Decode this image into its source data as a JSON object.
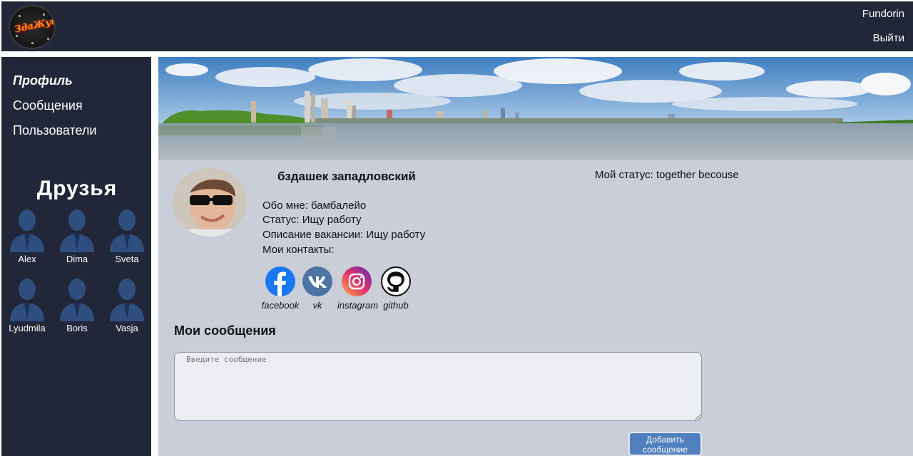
{
  "header": {
    "logo_text": "ЗдаЖуй",
    "login_name": "Fundorin",
    "logout_label": "Выйти"
  },
  "sidebar": {
    "nav": [
      {
        "label": "Профиль",
        "active": true
      },
      {
        "label": "Сообщения",
        "active": false
      },
      {
        "label": "Пользователи",
        "active": false
      }
    ],
    "friends_title": "Друзья",
    "friends": [
      "Alex",
      "Dima",
      "Sveta",
      "Lyudmila",
      "Boris",
      "Vasja"
    ]
  },
  "profile": {
    "full_name": "бздашек западловский",
    "my_status": "Мой статус: together becouse",
    "about": "Обо мне: бамбалейо",
    "job_status": "Статус: Ищу работу",
    "job_description": "Описание вакансии: Ищу работу",
    "contacts_label": "Мои контакты:",
    "contacts": [
      {
        "label": "facebook",
        "icon": "facebook-icon",
        "color": "#1877f2"
      },
      {
        "label": "vk",
        "icon": "vk-icon",
        "color": "#4c75a3"
      },
      {
        "label": "instagram",
        "icon": "instagram-icon",
        "color": "#d6249f"
      },
      {
        "label": "github",
        "icon": "github-icon",
        "color": "#111111"
      }
    ]
  },
  "posts": {
    "title": "Мои сообщения",
    "input_placeholder": "Введите сообщение",
    "add_label": "Добавить сообщение"
  },
  "colors": {
    "header_bg": "#212638",
    "content_bg": "#c9ced9",
    "button_bg": "#4f7fbd"
  }
}
